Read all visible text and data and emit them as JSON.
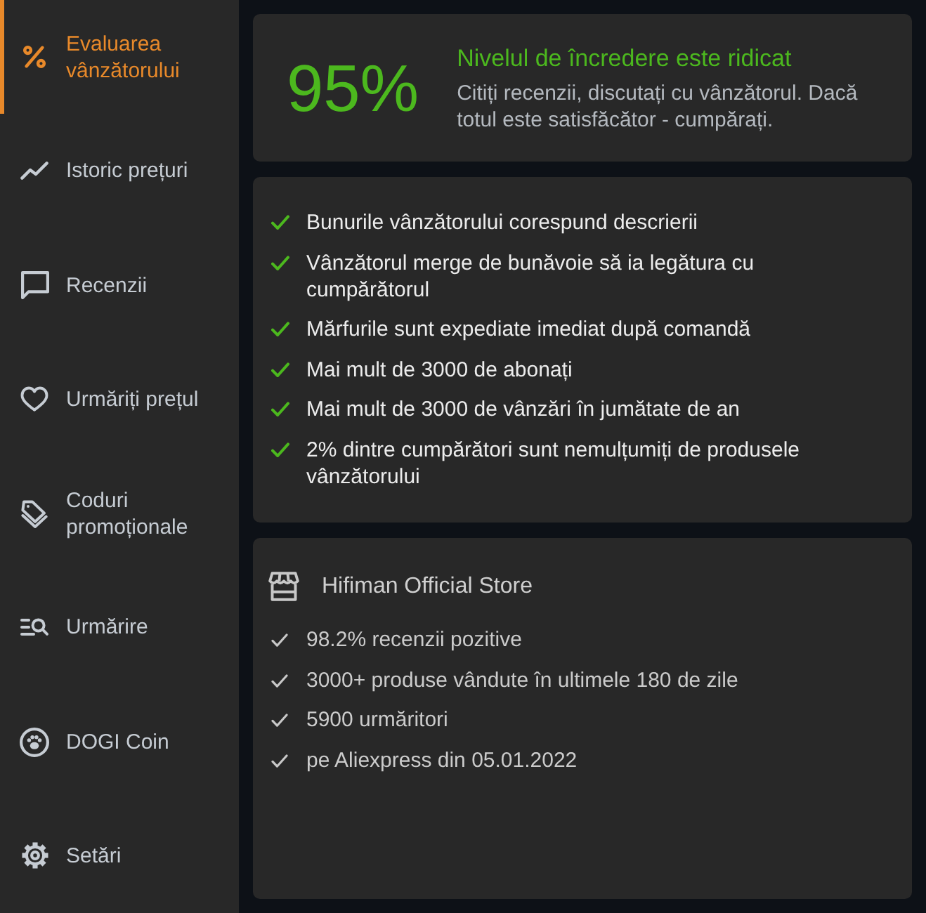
{
  "sidebar": {
    "items": [
      {
        "label": "Evaluarea vânzătorului",
        "selected": true
      },
      {
        "label": "Istoric prețuri",
        "selected": false
      },
      {
        "label": "Recenzii",
        "selected": false
      },
      {
        "label": "Urmăriți prețul",
        "selected": false
      },
      {
        "label": "Coduri promoționale",
        "selected": false
      },
      {
        "label": "Urmărire",
        "selected": false
      },
      {
        "label": "DOGI Coin",
        "selected": false
      },
      {
        "label": "Setări",
        "selected": false
      }
    ]
  },
  "trust": {
    "score": "95%",
    "title": "Nivelul de încredere este ridicat",
    "description": "Citiți recenzii, discutați cu vânzătorul. Dacă totul este satisfăcător - cumpărați."
  },
  "criteria": [
    "Bunurile vânzătorului corespund descrierii",
    "Vânzătorul merge de bunăvoie să ia legătura cu cumpărătorul",
    "Mărfurile sunt expediate imediat după comandă",
    "Mai mult de 3000 de abonați",
    "Mai mult de 3000 de vânzări în jumătate de an",
    "2% dintre cumpărători sunt nemulțumiți de produsele vânzătorului"
  ],
  "store": {
    "name": "Hifiman Official Store",
    "facts": [
      "98.2% recenzii pozitive",
      "3000+ produse vândute în ultimele 180 de zile",
      "5900 urmăritori",
      "pe Aliexpress din 05.01.2022"
    ]
  }
}
